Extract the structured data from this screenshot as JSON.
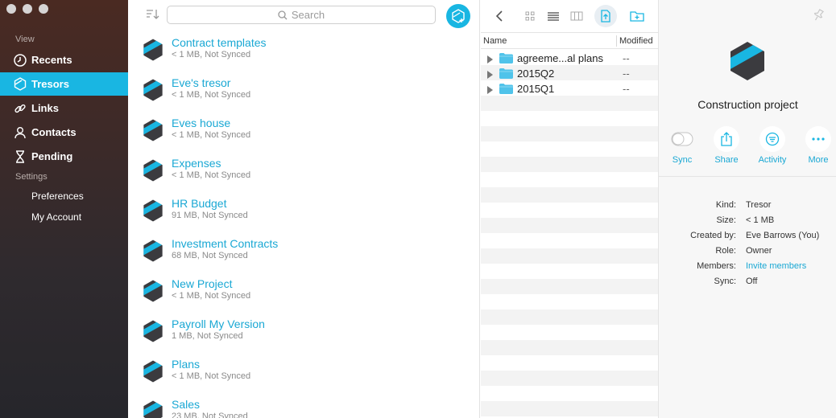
{
  "sidebar": {
    "section_view": "View",
    "section_settings": "Settings",
    "nav": [
      {
        "label": "Recents",
        "icon": "clock-icon",
        "active": false
      },
      {
        "label": "Tresors",
        "icon": "tresor-icon",
        "active": true
      },
      {
        "label": "Links",
        "icon": "link-icon",
        "active": false
      },
      {
        "label": "Contacts",
        "icon": "person-icon",
        "active": false
      },
      {
        "label": "Pending",
        "icon": "hourglass-icon",
        "active": false
      }
    ],
    "settings": [
      {
        "label": "Preferences"
      },
      {
        "label": "My Account"
      }
    ]
  },
  "list": {
    "search_placeholder": "Search",
    "tresors": [
      {
        "name": "Contract templates",
        "meta": "< 1 MB, Not Synced"
      },
      {
        "name": "Eve's tresor",
        "meta": "< 1 MB, Not Synced"
      },
      {
        "name": "Eves house",
        "meta": "< 1 MB, Not Synced"
      },
      {
        "name": "Expenses",
        "meta": "< 1 MB, Not Synced"
      },
      {
        "name": "HR Budget",
        "meta": "91 MB, Not Synced"
      },
      {
        "name": "Investment Contracts",
        "meta": "68 MB, Not Synced"
      },
      {
        "name": "New Project",
        "meta": "< 1 MB, Not Synced"
      },
      {
        "name": "Payroll My Version",
        "meta": "1 MB, Not Synced"
      },
      {
        "name": "Plans",
        "meta": "< 1 MB, Not Synced"
      },
      {
        "name": "Sales",
        "meta": "23 MB, Not Synced"
      }
    ]
  },
  "files": {
    "col_name": "Name",
    "col_modified": "Modified",
    "rows": [
      {
        "name": "agreeme...al plans",
        "modified": "--"
      },
      {
        "name": "2015Q2",
        "modified": "--"
      },
      {
        "name": "2015Q1",
        "modified": "--"
      }
    ]
  },
  "detail": {
    "title": "Construction project",
    "actions": [
      {
        "label": "Sync",
        "icon": "toggle-icon"
      },
      {
        "label": "Share",
        "icon": "share-icon"
      },
      {
        "label": "Activity",
        "icon": "activity-icon"
      },
      {
        "label": "More",
        "icon": "more-icon"
      }
    ],
    "info": [
      {
        "key": "Kind:",
        "value": "Tresor"
      },
      {
        "key": "Size:",
        "value": "< 1 MB"
      },
      {
        "key": "Created by:",
        "value": "Eve Barrows (You)"
      },
      {
        "key": "Role:",
        "value": "Owner"
      },
      {
        "key": "Members:",
        "value": "Invite members"
      },
      {
        "key": "Sync:",
        "value": "Off"
      }
    ]
  },
  "colors": {
    "accent": "#19b6e2",
    "logo_dark": "#3b3b3f"
  }
}
